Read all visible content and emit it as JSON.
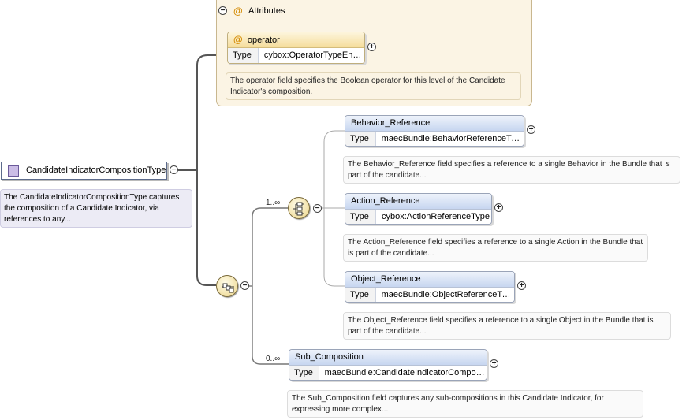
{
  "root": {
    "name": "CandidateIndicatorCompositionType",
    "description": "The CandidateIndicatorCompositionType captures the composition of a Candidate Indicator, via references to any..."
  },
  "attributes": {
    "title": "Attributes",
    "at_symbol": "@",
    "items": [
      {
        "name": "operator",
        "type_key": "Type",
        "type": "cybox:OperatorTypeEnum",
        "description": "The operator field specifies the Boolean operator for this level of the Candidate Indicator's composition."
      }
    ]
  },
  "choice": {
    "cardinality": "1..∞"
  },
  "elements": [
    {
      "name": "Behavior_Reference",
      "type_key": "Type",
      "type": "maecBundle:BehaviorReferenceType",
      "description": "The Behavior_Reference field specifies a reference to a single Behavior in the Bundle that is part of the candidate..."
    },
    {
      "name": "Action_Reference",
      "type_key": "Type",
      "type": "cybox:ActionReferenceType",
      "description": "The Action_Reference field specifies a reference to a single Action in the Bundle that is part of the candidate..."
    },
    {
      "name": "Object_Reference",
      "type_key": "Type",
      "type": "maecBundle:ObjectReferenceType",
      "description": "The Object_Reference field specifies a reference to a single Object in the Bundle that is part of the candidate..."
    },
    {
      "name": "Sub_Composition",
      "type_key": "Type",
      "type": "maecBundle:CandidateIndicatorCompositi...",
      "cardinality": "0..∞",
      "description": "The Sub_Composition field captures any sub-compositions in this Candidate Indicator, for expressing more complex..."
    }
  ],
  "toggles": {
    "collapse": "−",
    "expand": "+"
  },
  "colors": {
    "attribute_accent": "#d48a00",
    "element_header": "#c7d6f0",
    "type_box": "#cbbde6"
  }
}
